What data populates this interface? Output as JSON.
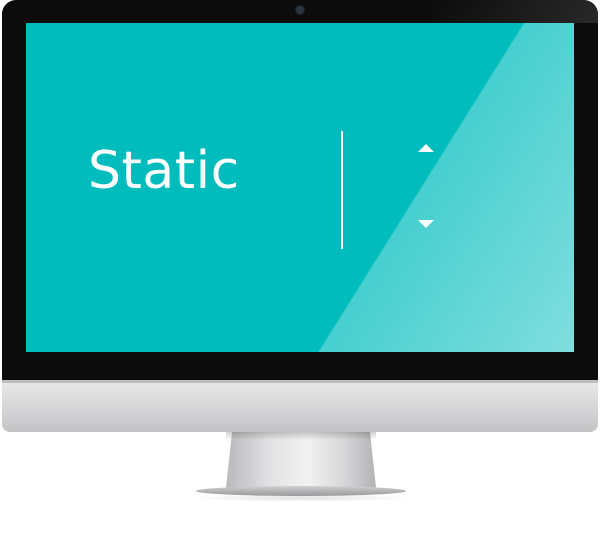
{
  "screen": {
    "label": "Static",
    "background_color": "#00bcbd",
    "foreground_color": "#ffffff"
  },
  "controls": {
    "up_icon": "triangle-up-icon",
    "down_icon": "triangle-down-icon"
  }
}
